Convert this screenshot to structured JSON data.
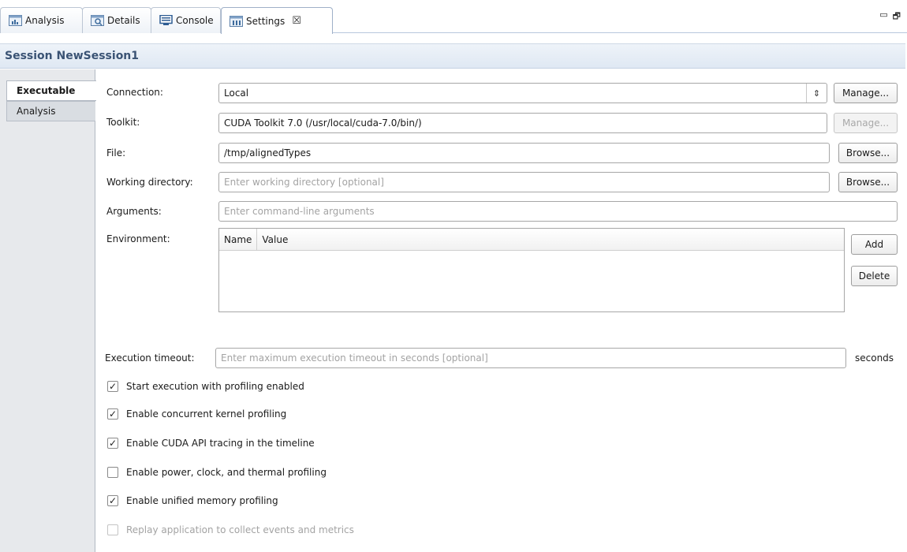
{
  "tabs": [
    {
      "label": "Analysis",
      "icon": "analysis-icon"
    },
    {
      "label": "Details",
      "icon": "details-icon"
    },
    {
      "label": "Console",
      "icon": "console-icon"
    },
    {
      "label": "Settings",
      "icon": "settings-icon",
      "close": "☒"
    }
  ],
  "window_controls": {
    "minimize": "▭",
    "restore": "🗗"
  },
  "session": {
    "title": "Session NewSession1"
  },
  "sidetabs": [
    {
      "label": "Executable"
    },
    {
      "label": "Analysis"
    }
  ],
  "form": {
    "connection": {
      "label": "Connection:",
      "value": "Local",
      "spin": "⇕",
      "manage": "Manage..."
    },
    "toolkit": {
      "label": "Toolkit:",
      "value": "CUDA Toolkit 7.0 (/usr/local/cuda-7.0/bin/)",
      "manage": "Manage..."
    },
    "file": {
      "label": "File:",
      "value": "/tmp/alignedTypes",
      "browse": "Browse..."
    },
    "working_dir": {
      "label": "Working directory:",
      "placeholder": "Enter working directory [optional]",
      "browse": "Browse..."
    },
    "arguments": {
      "label": "Arguments:",
      "placeholder": "Enter command-line arguments"
    },
    "environment": {
      "label": "Environment:",
      "col_name": "Name",
      "col_value": "Value",
      "add": "Add",
      "delete": "Delete"
    },
    "timeout": {
      "label": "Execution timeout:",
      "placeholder": "Enter maximum execution timeout in seconds [optional]",
      "unit": "seconds"
    }
  },
  "checkboxes": [
    {
      "label": "Start execution with profiling enabled",
      "checked": true,
      "mark": "✓"
    },
    {
      "label": "Enable concurrent kernel profiling",
      "checked": true,
      "mark": "✓"
    },
    {
      "label": "Enable CUDA API tracing in the timeline",
      "checked": true,
      "mark": "✓"
    },
    {
      "label": "Enable power, clock, and thermal profiling",
      "checked": false,
      "mark": ""
    },
    {
      "label": "Enable unified memory profiling",
      "checked": true,
      "mark": "✓"
    },
    {
      "label": "Replay application to collect events and metrics",
      "checked": false,
      "mark": ""
    }
  ]
}
